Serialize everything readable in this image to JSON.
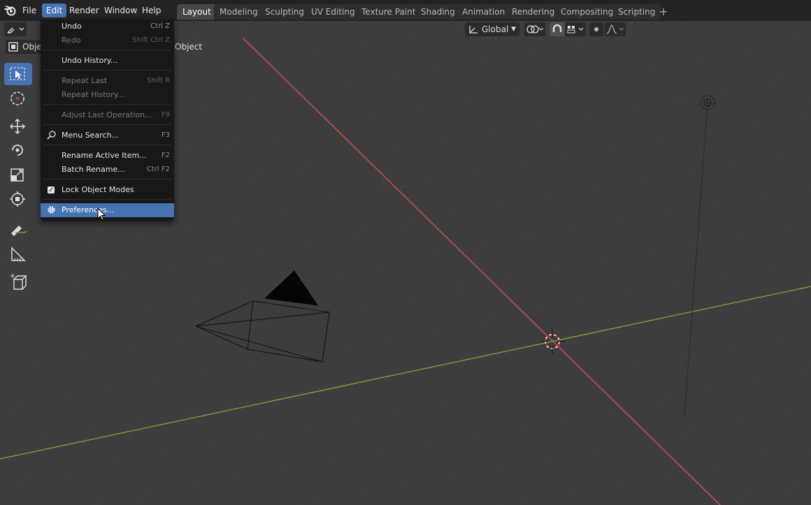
{
  "menubar": {
    "items": [
      "File",
      "Edit",
      "Render",
      "Window",
      "Help"
    ],
    "active": "Edit"
  },
  "workspaces": {
    "tabs": [
      "Layout",
      "Modeling",
      "Sculpting",
      "UV Editing",
      "Texture Paint",
      "Shading",
      "Animation",
      "Rendering",
      "Compositing",
      "Scripting"
    ],
    "active": "Layout",
    "add_symbol": "+"
  },
  "viewport_header": {
    "mode_label": "Objec",
    "object_menu_label": "Object",
    "transform_orientation": "Global"
  },
  "edit_menu": {
    "items": [
      {
        "label": "Undo",
        "shortcut": "Ctrl Z",
        "enabled": true
      },
      {
        "label": "Redo",
        "shortcut": "Shift Ctrl Z",
        "enabled": false
      },
      {
        "label": "Undo History...",
        "shortcut": "",
        "enabled": true
      },
      {
        "label": "Repeat Last",
        "shortcut": "Shift R",
        "enabled": false
      },
      {
        "label": "Repeat History...",
        "shortcut": "",
        "enabled": false
      },
      {
        "label": "Adjust Last Operation...",
        "shortcut": "F9",
        "enabled": false
      },
      {
        "label": "Menu Search...",
        "shortcut": "F3",
        "enabled": true,
        "icon": "search-icon"
      },
      {
        "label": "Rename Active Item...",
        "shortcut": "F2",
        "enabled": true
      },
      {
        "label": "Batch Rename...",
        "shortcut": "Ctrl F2",
        "enabled": true
      },
      {
        "label": "Lock Object Modes",
        "shortcut": "",
        "enabled": true,
        "checked": true
      },
      {
        "label": "Preferences...",
        "shortcut": "",
        "enabled": true,
        "highlighted": true,
        "icon": "gear-icon"
      }
    ]
  },
  "colors": {
    "accent": "#4772b3",
    "viewport_bg": "#3d3d3d",
    "x_axis": "#c04a5a",
    "y_axis": "#7fa035"
  }
}
